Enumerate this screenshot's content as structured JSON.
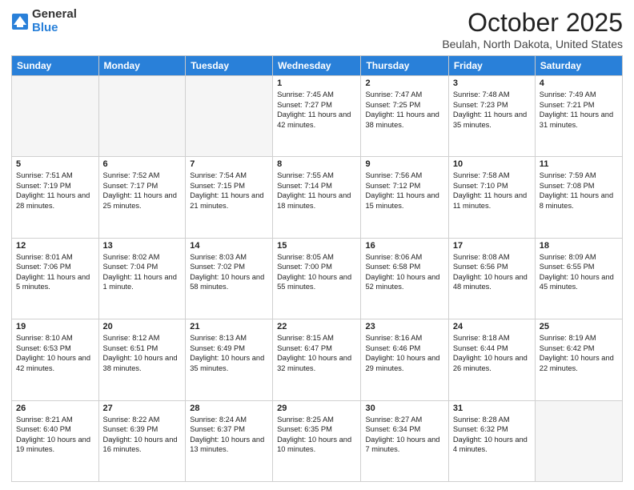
{
  "logo": {
    "general": "General",
    "blue": "Blue"
  },
  "header": {
    "month": "October 2025",
    "location": "Beulah, North Dakota, United States"
  },
  "weekdays": [
    "Sunday",
    "Monday",
    "Tuesday",
    "Wednesday",
    "Thursday",
    "Friday",
    "Saturday"
  ],
  "weeks": [
    [
      {
        "day": "",
        "info": ""
      },
      {
        "day": "",
        "info": ""
      },
      {
        "day": "",
        "info": ""
      },
      {
        "day": "1",
        "info": "Sunrise: 7:45 AM\nSunset: 7:27 PM\nDaylight: 11 hours and 42 minutes."
      },
      {
        "day": "2",
        "info": "Sunrise: 7:47 AM\nSunset: 7:25 PM\nDaylight: 11 hours and 38 minutes."
      },
      {
        "day": "3",
        "info": "Sunrise: 7:48 AM\nSunset: 7:23 PM\nDaylight: 11 hours and 35 minutes."
      },
      {
        "day": "4",
        "info": "Sunrise: 7:49 AM\nSunset: 7:21 PM\nDaylight: 11 hours and 31 minutes."
      }
    ],
    [
      {
        "day": "5",
        "info": "Sunrise: 7:51 AM\nSunset: 7:19 PM\nDaylight: 11 hours and 28 minutes."
      },
      {
        "day": "6",
        "info": "Sunrise: 7:52 AM\nSunset: 7:17 PM\nDaylight: 11 hours and 25 minutes."
      },
      {
        "day": "7",
        "info": "Sunrise: 7:54 AM\nSunset: 7:15 PM\nDaylight: 11 hours and 21 minutes."
      },
      {
        "day": "8",
        "info": "Sunrise: 7:55 AM\nSunset: 7:14 PM\nDaylight: 11 hours and 18 minutes."
      },
      {
        "day": "9",
        "info": "Sunrise: 7:56 AM\nSunset: 7:12 PM\nDaylight: 11 hours and 15 minutes."
      },
      {
        "day": "10",
        "info": "Sunrise: 7:58 AM\nSunset: 7:10 PM\nDaylight: 11 hours and 11 minutes."
      },
      {
        "day": "11",
        "info": "Sunrise: 7:59 AM\nSunset: 7:08 PM\nDaylight: 11 hours and 8 minutes."
      }
    ],
    [
      {
        "day": "12",
        "info": "Sunrise: 8:01 AM\nSunset: 7:06 PM\nDaylight: 11 hours and 5 minutes."
      },
      {
        "day": "13",
        "info": "Sunrise: 8:02 AM\nSunset: 7:04 PM\nDaylight: 11 hours and 1 minute."
      },
      {
        "day": "14",
        "info": "Sunrise: 8:03 AM\nSunset: 7:02 PM\nDaylight: 10 hours and 58 minutes."
      },
      {
        "day": "15",
        "info": "Sunrise: 8:05 AM\nSunset: 7:00 PM\nDaylight: 10 hours and 55 minutes."
      },
      {
        "day": "16",
        "info": "Sunrise: 8:06 AM\nSunset: 6:58 PM\nDaylight: 10 hours and 52 minutes."
      },
      {
        "day": "17",
        "info": "Sunrise: 8:08 AM\nSunset: 6:56 PM\nDaylight: 10 hours and 48 minutes."
      },
      {
        "day": "18",
        "info": "Sunrise: 8:09 AM\nSunset: 6:55 PM\nDaylight: 10 hours and 45 minutes."
      }
    ],
    [
      {
        "day": "19",
        "info": "Sunrise: 8:10 AM\nSunset: 6:53 PM\nDaylight: 10 hours and 42 minutes."
      },
      {
        "day": "20",
        "info": "Sunrise: 8:12 AM\nSunset: 6:51 PM\nDaylight: 10 hours and 38 minutes."
      },
      {
        "day": "21",
        "info": "Sunrise: 8:13 AM\nSunset: 6:49 PM\nDaylight: 10 hours and 35 minutes."
      },
      {
        "day": "22",
        "info": "Sunrise: 8:15 AM\nSunset: 6:47 PM\nDaylight: 10 hours and 32 minutes."
      },
      {
        "day": "23",
        "info": "Sunrise: 8:16 AM\nSunset: 6:46 PM\nDaylight: 10 hours and 29 minutes."
      },
      {
        "day": "24",
        "info": "Sunrise: 8:18 AM\nSunset: 6:44 PM\nDaylight: 10 hours and 26 minutes."
      },
      {
        "day": "25",
        "info": "Sunrise: 8:19 AM\nSunset: 6:42 PM\nDaylight: 10 hours and 22 minutes."
      }
    ],
    [
      {
        "day": "26",
        "info": "Sunrise: 8:21 AM\nSunset: 6:40 PM\nDaylight: 10 hours and 19 minutes."
      },
      {
        "day": "27",
        "info": "Sunrise: 8:22 AM\nSunset: 6:39 PM\nDaylight: 10 hours and 16 minutes."
      },
      {
        "day": "28",
        "info": "Sunrise: 8:24 AM\nSunset: 6:37 PM\nDaylight: 10 hours and 13 minutes."
      },
      {
        "day": "29",
        "info": "Sunrise: 8:25 AM\nSunset: 6:35 PM\nDaylight: 10 hours and 10 minutes."
      },
      {
        "day": "30",
        "info": "Sunrise: 8:27 AM\nSunset: 6:34 PM\nDaylight: 10 hours and 7 minutes."
      },
      {
        "day": "31",
        "info": "Sunrise: 8:28 AM\nSunset: 6:32 PM\nDaylight: 10 hours and 4 minutes."
      },
      {
        "day": "",
        "info": ""
      }
    ]
  ]
}
